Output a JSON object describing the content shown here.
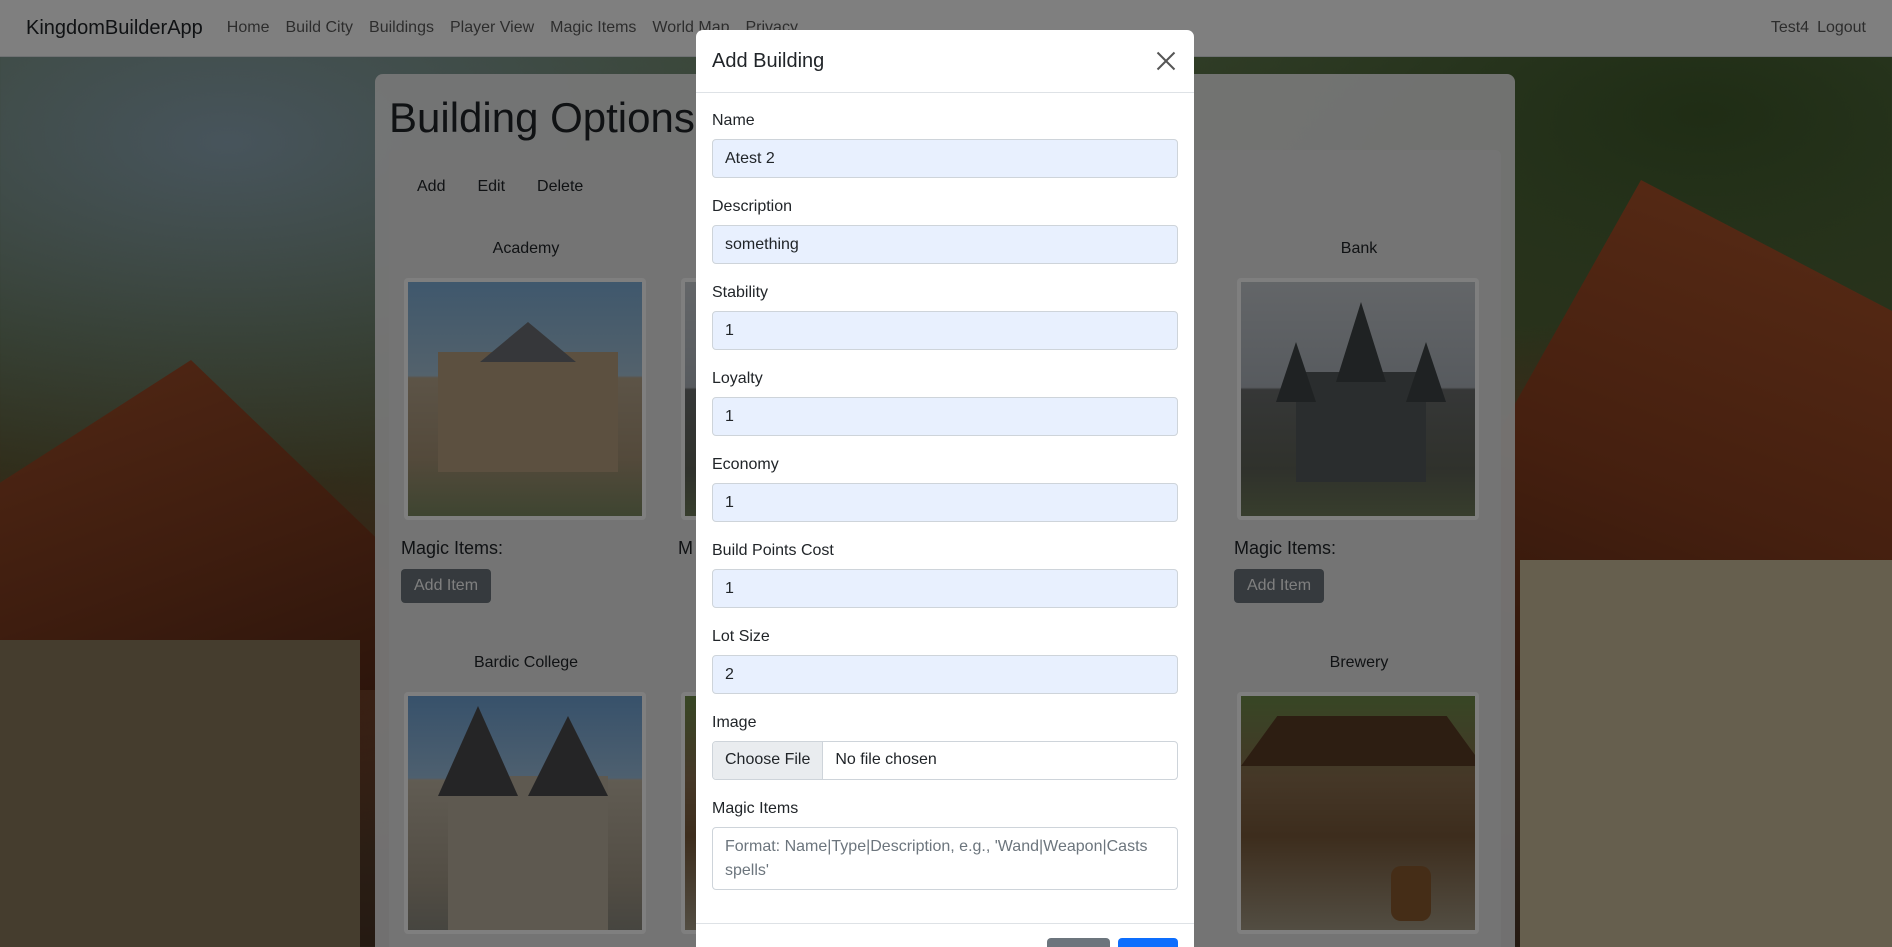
{
  "navbar": {
    "brand": "KingdomBuilderApp",
    "links": [
      "Home",
      "Build City",
      "Buildings",
      "Player View",
      "Magic Items",
      "World Map",
      "Privacy"
    ],
    "user": "Test4",
    "logout": "Logout"
  },
  "page": {
    "title": "Building Options",
    "toolbar": {
      "add": "Add",
      "edit": "Edit",
      "delete": "Delete"
    },
    "cards": [
      {
        "title": "Academy",
        "magic_items_label": "Magic Items:",
        "add_item": "Add Item"
      },
      {
        "title": "Bank",
        "magic_items_label": "Magic Items:",
        "add_item": "Add Item"
      },
      {
        "title": "Bardic College"
      },
      {
        "title": "Brewery"
      }
    ],
    "partial_card": {
      "magic_items_label_fragment": "M"
    }
  },
  "modal": {
    "title": "Add Building",
    "fields": {
      "name": {
        "label": "Name",
        "value": "Atest 2"
      },
      "description": {
        "label": "Description",
        "value": "something"
      },
      "stability": {
        "label": "Stability",
        "value": "1"
      },
      "loyalty": {
        "label": "Loyalty",
        "value": "1"
      },
      "economy": {
        "label": "Economy",
        "value": "1"
      },
      "build_points_cost": {
        "label": "Build Points Cost",
        "value": "1"
      },
      "lot_size": {
        "label": "Lot Size",
        "value": "2"
      },
      "image": {
        "label": "Image",
        "button": "Choose File",
        "status": "No file chosen"
      },
      "magic_items": {
        "label": "Magic Items",
        "placeholder": "Format: Name|Type|Description, e.g., 'Wand|Weapon|Casts spells'"
      }
    }
  },
  "colors": {
    "primary": "#0d6efd",
    "secondary": "#6c757d"
  }
}
